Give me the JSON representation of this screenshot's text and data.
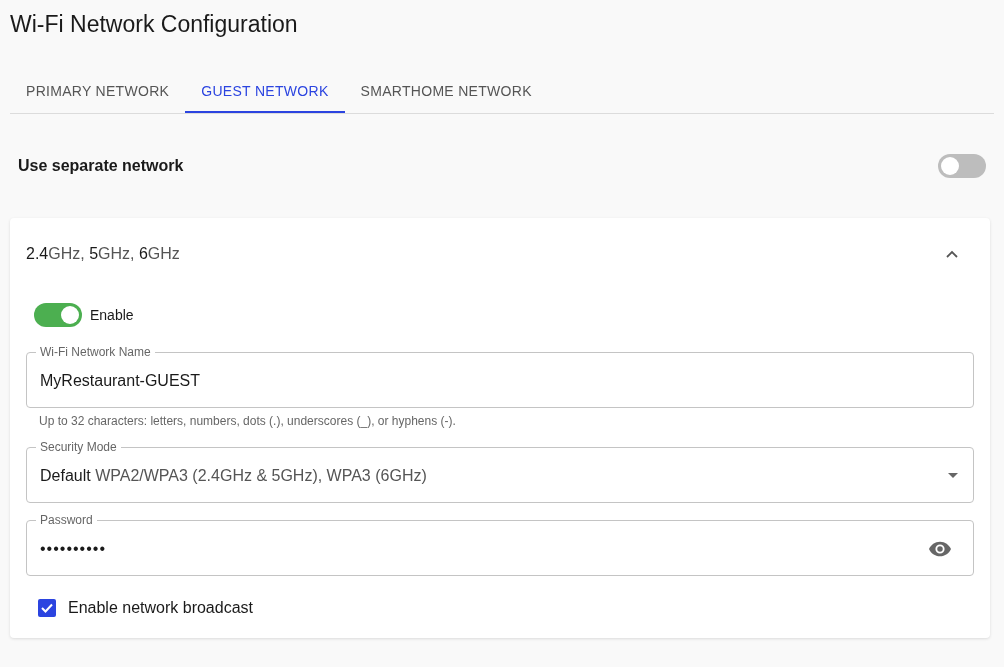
{
  "title": "Wi-Fi Network Configuration",
  "tabs": [
    {
      "label": "PRIMARY NETWORK",
      "selected": false
    },
    {
      "label": "GUEST NETWORK",
      "selected": true
    },
    {
      "label": "SMARTHOME NETWORK",
      "selected": false
    }
  ],
  "separate_network": {
    "label": "Use separate network",
    "on": false
  },
  "band_panel": {
    "title": "**2.4**GHz, **5**GHz, **6**GHz",
    "expanded": true,
    "enable": {
      "label": "Enable",
      "on": true
    },
    "network_name": {
      "label": "Wi-Fi Network Name",
      "value": "MyRestaurant-GUEST",
      "helper": "Up to 32 characters: letters, numbers, dots (.), underscores (_), or hyphens (-)."
    },
    "security_mode": {
      "label": "Security Mode",
      "value_main": "Default",
      "value_detail": "WPA2/WPA3 (2.4GHz & 5GHz), WPA3 (6GHz)"
    },
    "password": {
      "label": "Password",
      "value": "••••••••••"
    },
    "broadcast": {
      "label": "Enable network broadcast",
      "checked": true
    }
  }
}
